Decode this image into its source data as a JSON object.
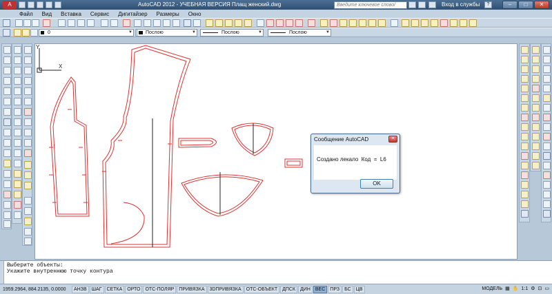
{
  "titlebar": {
    "app_logo": "A",
    "title": "AutoCAD 2012 - УЧЕБНАЯ ВЕРСИЯ    Плащ женский.dwg",
    "search_placeholder": "Введите ключевое слово/фразу",
    "signin": "Вход в службы",
    "help": "?",
    "minimize": "–",
    "maximize": "□",
    "close": "✕"
  },
  "menubar": {
    "items": [
      "Файл",
      "Вид",
      "Вставка",
      "Сервис",
      "Дигитайзер",
      "Размеры",
      "Окно"
    ]
  },
  "properties": {
    "layer": "0",
    "color": "Послою",
    "linetype": "Послою",
    "lineweight": "Послою"
  },
  "dialog": {
    "title": "Сообщение AutoCAD",
    "message": "Создано лекало  Код  =  L6",
    "ok_label": "OK",
    "close_label": "✕"
  },
  "command_line": {
    "line1": "Выберите объекты:",
    "line2": "Укажите внутреннюю точку контура"
  },
  "status": {
    "coords": "1959.2964, 884.2135, 0.0000",
    "toggles": [
      {
        "label": "АНЗВ",
        "on": false
      },
      {
        "label": "ШАГ",
        "on": false
      },
      {
        "label": "СЕТКА",
        "on": false
      },
      {
        "label": "ОРТО",
        "on": false
      },
      {
        "label": "ОТС-ПОЛЯР",
        "on": false
      },
      {
        "label": "ПРИВЯЗКА",
        "on": false
      },
      {
        "label": "3DПРИВЯЗКА",
        "on": false
      },
      {
        "label": "ОТС-ОБЪЕКТ",
        "on": false
      },
      {
        "label": "ДПСК",
        "on": false
      },
      {
        "label": "ДИН",
        "on": false
      },
      {
        "label": "ВЕС",
        "on": true
      },
      {
        "label": "ПРЗ",
        "on": false
      },
      {
        "label": "БС",
        "on": false
      },
      {
        "label": "ЦВ",
        "on": false
      }
    ],
    "model": "МОДЕЛЬ",
    "scale": "1:1"
  },
  "ucs": {
    "x": "X",
    "y": "Y"
  },
  "colors": {
    "outline": "#e03030",
    "drawing": "#222222"
  }
}
